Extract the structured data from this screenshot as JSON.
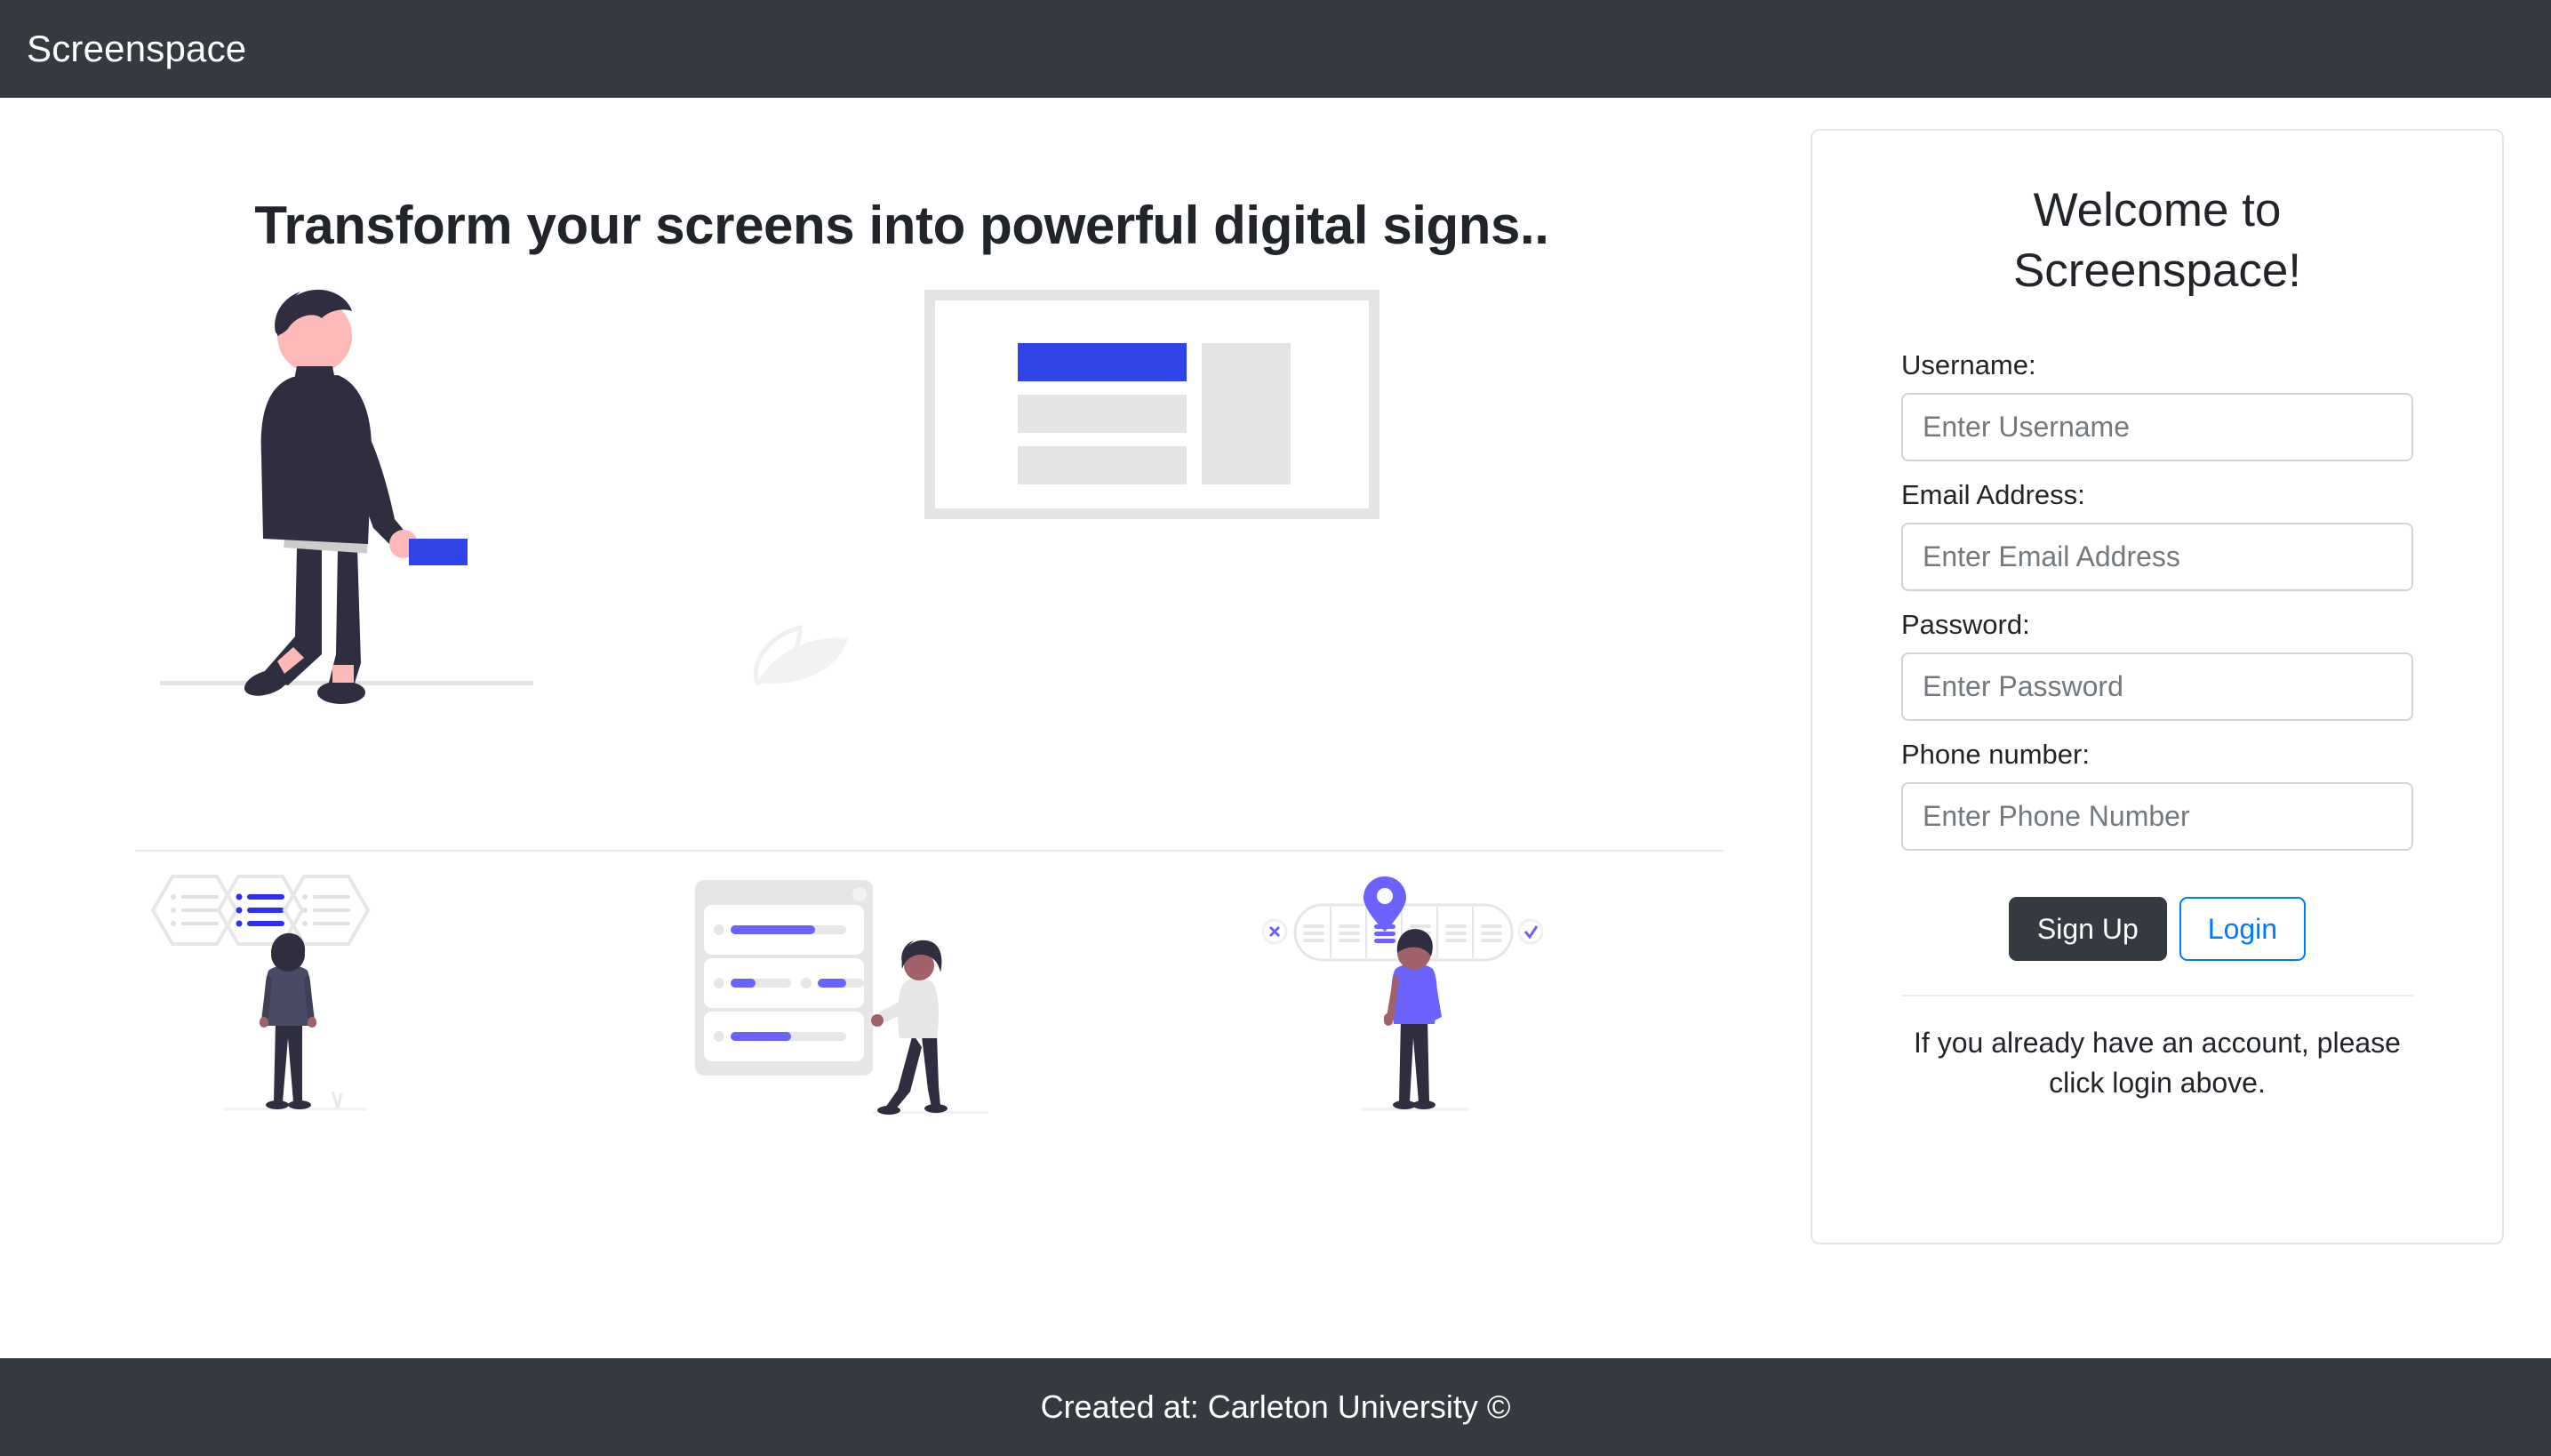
{
  "navbar": {
    "brand": "Screenspace"
  },
  "hero": {
    "title": "Transform your screens into powerful digital signs..",
    "illustration_name": "walking-businessman-with-digital-sign-screen",
    "screen_mockup": {
      "highlight_bar_color": "#2f44e8",
      "placeholder_bar_color": "#e4e4e4",
      "frame_color": "#e4e4e4"
    },
    "briefcase_color": "#2f44e8",
    "figure_color": "#2f2e41",
    "skin_color": "#ffb8b8"
  },
  "features": [
    {
      "name": "content-selection-illustration",
      "description": "Three hexagon cards with list lines, middle one highlighted, person viewing from behind",
      "accent_color": "#2f2ef5",
      "muted_color": "#e6e6e6"
    },
    {
      "name": "playlist-progress-illustration",
      "description": "Stacked panel rows with progress bars and a walking woman",
      "accent_color": "#6c63ff",
      "muted_color": "#e6e6e6"
    },
    {
      "name": "schedule-timeline-illustration",
      "description": "Horizontal carousel of slides with a map pin marker and a standing person",
      "accent_color": "#6c63ff",
      "muted_color": "#e6e6e6"
    }
  ],
  "signup": {
    "title": "Welcome to Screenspace!",
    "fields": [
      {
        "label": "Username:",
        "placeholder": "Enter Username",
        "value": "",
        "type": "text"
      },
      {
        "label": "Email Address:",
        "placeholder": "Enter Email Address",
        "value": "",
        "type": "text"
      },
      {
        "label": "Password:",
        "placeholder": "Enter Password",
        "value": "",
        "type": "password"
      },
      {
        "label": "Phone number:",
        "placeholder": "Enter Phone Number",
        "value": "",
        "type": "text"
      }
    ],
    "signup_button": "Sign Up",
    "login_button": "Login",
    "note": "If you already have an account, please click login above."
  },
  "footer": {
    "text": "Created at: Carleton University ©"
  },
  "theme": {
    "navbar_bg": "#343a40",
    "footer_bg": "#343a40",
    "primary_blue": "#007bff",
    "dark_button": "#343a40",
    "input_border": "#ced4da",
    "card_border": "#e4e4e6"
  }
}
